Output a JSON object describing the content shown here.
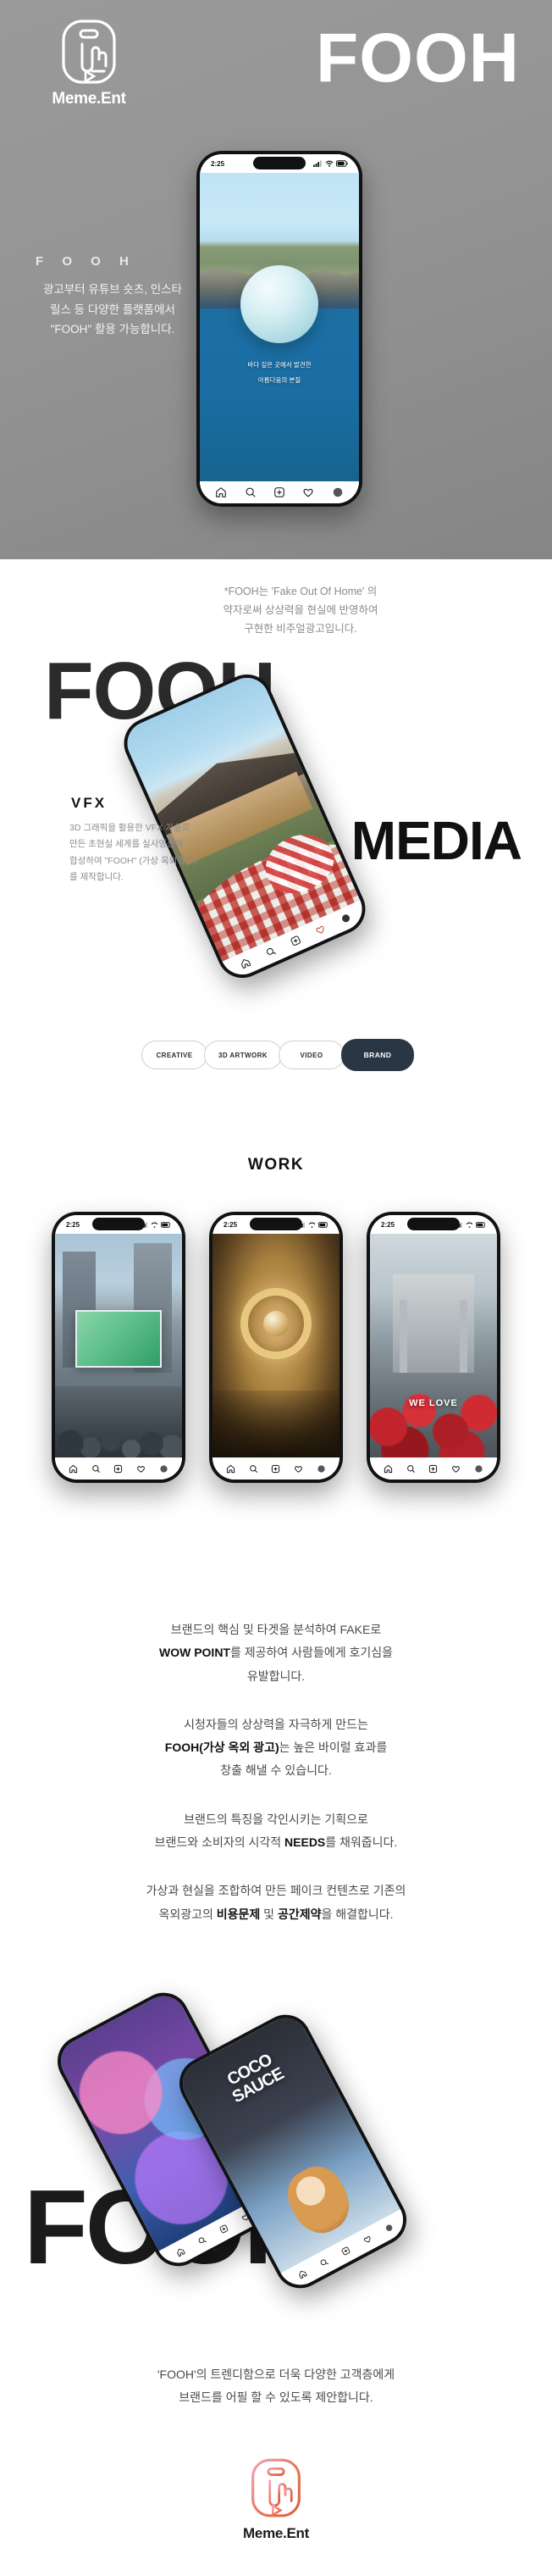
{
  "brand": {
    "name": "Meme.Ent",
    "logo_icon": "hand-tap-in-phone-icon"
  },
  "hero": {
    "title": "FOOH",
    "sub_word": "F O O H",
    "description": "광고부터 유튜브 숏츠, 인스타\n릴스 등 다양한 플랫폼에서\n\"FOOH\" 활용 가능합니다.",
    "bg_color": "#949494",
    "phone": {
      "status_time": "2:25",
      "status_icons": [
        "cellular-signal-icon",
        "wifi-icon",
        "battery-icon"
      ],
      "caption_line1": "바다 깊은 곳에서 발견한",
      "caption_line2": "아름다움의 본질",
      "nav_items": [
        "home-icon",
        "search-icon",
        "add-post-icon",
        "heart-icon",
        "profile-avatar-icon"
      ]
    }
  },
  "media": {
    "note": "*FOOH는 'Fake Out Of Home' 의\n약자로써  상상력을  현실에  반영하여\n구현한 비주얼광고입니다.",
    "word_fooh": "FOOH",
    "word_media": "MEDIA",
    "vfx_label": "VFX",
    "vfx_desc": "3D 그래픽을  활용한  VFX  기술로\n만든   초현실   세계를   실사영상에\n합성하여 \"FOOH\" (가상 옥외광고)\n를 제작합니다.",
    "pills": [
      {
        "label": "CREATIVE",
        "active": false
      },
      {
        "label": "3D ARTWORK",
        "active": false
      },
      {
        "label": "VIDEO",
        "active": false
      },
      {
        "label": "BRAND",
        "active": true
      }
    ],
    "accent_dark": "#2b3645"
  },
  "work": {
    "title": "WORK",
    "items": [
      {
        "name": "city-billboard",
        "status_time": "2:25",
        "overlay": ""
      },
      {
        "name": "gold-ornate",
        "status_time": "2:25",
        "overlay": ""
      },
      {
        "name": "red-flowers-gate",
        "status_time": "2:25",
        "overlay": "WE LOVE"
      }
    ]
  },
  "copy": {
    "paragraphs": [
      [
        {
          "t": "브랜드의 핵심 및 타겟을 분석하여 FAKE로",
          "b": false
        },
        {
          "t": "\n",
          "b": false
        },
        {
          "t": "WOW POINT",
          "b": true
        },
        {
          "t": "를 제공하여 사람들에게 호기심을",
          "b": false
        },
        {
          "t": "\n유발합니다.",
          "b": false
        }
      ],
      [
        {
          "t": "시청자들의 상상력을 자극하게 만드는",
          "b": false
        },
        {
          "t": "\n",
          "b": false
        },
        {
          "t": "FOOH(가상 옥외 광고)",
          "b": true
        },
        {
          "t": "는 높은 바이럴 효과를",
          "b": false
        },
        {
          "t": "\n창출 해낼 수 있습니다.",
          "b": false
        }
      ],
      [
        {
          "t": "브랜드의 특징을 각인시키는 기획으로",
          "b": false
        },
        {
          "t": "\n브랜드와 소비자의 시각적 ",
          "b": false
        },
        {
          "t": "NEEDS",
          "b": true
        },
        {
          "t": "를 채워줍니다.",
          "b": false
        }
      ],
      [
        {
          "t": "가상과 현실을 조합하여 만든 페이크 컨텐츠로 기존의",
          "b": false
        },
        {
          "t": "\n옥외광고의 ",
          "b": false
        },
        {
          "t": "비용문제",
          "b": true
        },
        {
          "t": " 및 ",
          "b": false
        },
        {
          "t": "공간제약",
          "b": true
        },
        {
          "t": "을 해결합니다.",
          "b": false
        }
      ]
    ]
  },
  "big_fooh": {
    "word": "FOOH",
    "phone_b_title": "COCO\nSAUCE"
  },
  "closing": {
    "text": "'FOOH'의 트렌디함으로 더욱 다양한 고객층에게\n브랜드를 어필 할 수 있도록 제안합니다."
  },
  "footer": {
    "name": "Meme.Ent",
    "logo_icon": "hand-tap-in-phone-icon"
  }
}
